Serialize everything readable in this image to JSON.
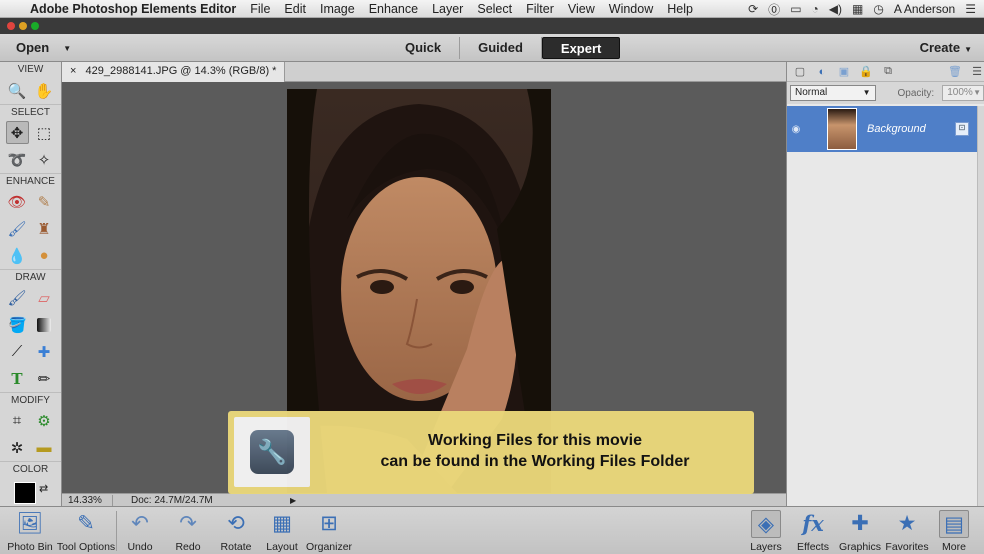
{
  "menubar": {
    "apple_icon": "apple-logo-icon",
    "app_name": "Adobe Photoshop Elements Editor",
    "menus": [
      "File",
      "Edit",
      "Image",
      "Enhance",
      "Layer",
      "Select",
      "Filter",
      "View",
      "Window",
      "Help"
    ],
    "user": "A Anderson"
  },
  "appbar": {
    "open_label": "Open",
    "modes": [
      "Quick",
      "Guided",
      "Expert"
    ],
    "active_mode": "Expert",
    "create_label": "Create"
  },
  "toolbox": {
    "sections": [
      "VIEW",
      "SELECT",
      "ENHANCE",
      "DRAW",
      "MODIFY",
      "COLOR"
    ],
    "foreground_color": "#000000"
  },
  "document": {
    "tab_close": "×",
    "tab_title": "429_2988141.JPG @ 14.3% (RGB/8) *",
    "zoom": "14.33%",
    "doc_info": "Doc: 24.7M/24.7M"
  },
  "notice": {
    "line1": "Working Files for this movie",
    "line2": "can be found in the Working Files Folder"
  },
  "layers_panel": {
    "blend_mode": "Normal",
    "opacity_label": "Opacity:",
    "opacity_value": "100%",
    "layers": [
      {
        "name": "Background"
      }
    ]
  },
  "taskbar": {
    "left_buttons": [
      "Photo Bin",
      "Tool Options",
      "Undo",
      "Redo",
      "Rotate",
      "Layout",
      "Organizer"
    ],
    "right_buttons": [
      "Layers",
      "Effects",
      "Graphics",
      "Favorites",
      "More"
    ]
  },
  "colors": {
    "accent_selection": "#4f7fc8",
    "notice_bg": "#ead77a",
    "active_mode_bg": "#2c2c2c"
  }
}
